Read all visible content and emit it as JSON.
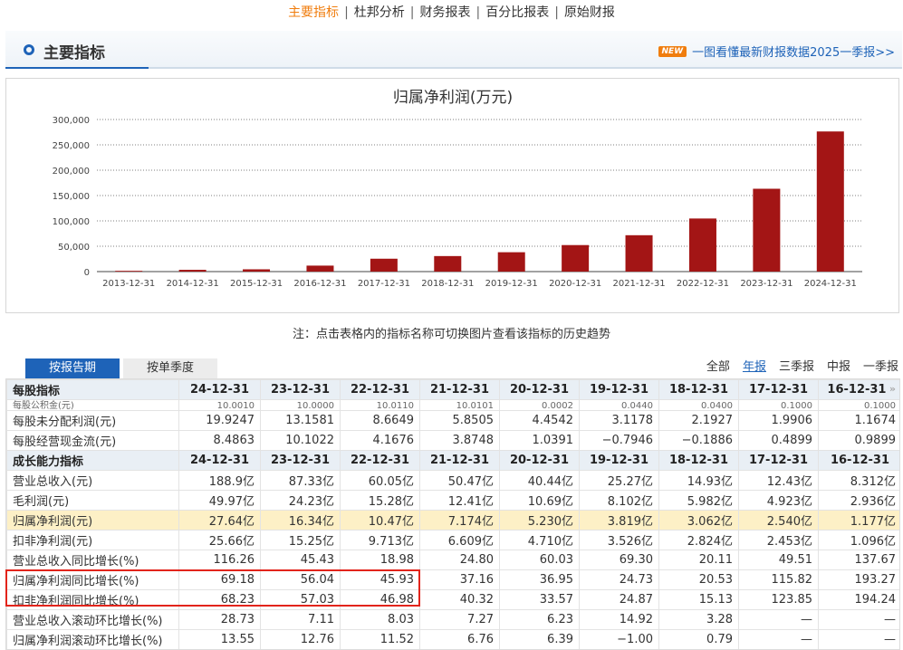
{
  "nav": {
    "items": [
      "主要指标",
      "杜邦分析",
      "财务报表",
      "百分比报表",
      "原始财报"
    ],
    "active": "主要指标"
  },
  "section": {
    "title": "主要指标",
    "news_badge": "NEW",
    "news_text": "一图看懂最新财报数据2025一季报>>"
  },
  "chart_data": {
    "type": "bar",
    "title": "归属净利润(万元)",
    "categories": [
      "2013-12-31",
      "2014-12-31",
      "2015-12-31",
      "2016-12-31",
      "2017-12-31",
      "2018-12-31",
      "2019-12-31",
      "2020-12-31",
      "2021-12-31",
      "2022-12-31",
      "2023-12-31",
      "2024-12-31"
    ],
    "values": [
      1500,
      3500,
      4500,
      11770,
      25400,
      30620,
      38190,
      52300,
      71740,
      104700,
      163400,
      276400
    ],
    "yticks": [
      "0",
      "50,000",
      "100,000",
      "150,000",
      "200,000",
      "250,000",
      "300,000"
    ],
    "ylim": [
      0,
      300000
    ],
    "bar_color": "#a31515",
    "grid": true
  },
  "note": "注：点击表格内的指标名称可切换图片查看该指标的历史趋势",
  "tabs": {
    "report": "按报告期",
    "quarter": "按单季度"
  },
  "period_filter": {
    "items": [
      "全部",
      "年报",
      "三季报",
      "中报",
      "一季报"
    ],
    "active": "年报"
  },
  "table": {
    "columns": [
      "24-12-31",
      "23-12-31",
      "22-12-31",
      "21-12-31",
      "20-12-31",
      "19-12-31",
      "18-12-31",
      "17-12-31",
      "16-12-31"
    ],
    "header1": "每股指标",
    "partial_row": {
      "name": "每股公积金(元)",
      "values": [
        "10.0010",
        "10.0000",
        "10.0110",
        "10.0101",
        "0.0002",
        "0.0440",
        "0.0400",
        "0.1000",
        "0.1000"
      ]
    },
    "group1": [
      {
        "name": "每股未分配利润(元)",
        "values": [
          "19.9247",
          "13.1581",
          "8.6649",
          "5.8505",
          "4.4542",
          "3.1178",
          "2.1927",
          "1.9906",
          "1.1674"
        ]
      },
      {
        "name": "每股经营现金流(元)",
        "values": [
          "8.4863",
          "10.1022",
          "4.1676",
          "3.8748",
          "1.0391",
          "−0.7946",
          "−0.1886",
          "0.4899",
          "0.9899"
        ]
      }
    ],
    "header2": "成长能力指标",
    "group2": [
      {
        "name": "营业总收入(元)",
        "values": [
          "188.9亿",
          "87.33亿",
          "60.05亿",
          "50.47亿",
          "40.44亿",
          "25.27亿",
          "14.93亿",
          "12.43亿",
          "8.312亿"
        ]
      },
      {
        "name": "毛利润(元)",
        "values": [
          "49.97亿",
          "24.23亿",
          "15.28亿",
          "12.41亿",
          "10.69亿",
          "8.102亿",
          "5.982亿",
          "4.923亿",
          "2.936亿"
        ]
      },
      {
        "name": "归属净利润(元)",
        "values": [
          "27.64亿",
          "16.34亿",
          "10.47亿",
          "7.174亿",
          "5.230亿",
          "3.819亿",
          "3.062亿",
          "2.540亿",
          "1.177亿"
        ],
        "highlight": true
      },
      {
        "name": "扣非净利润(元)",
        "values": [
          "25.66亿",
          "15.25亿",
          "9.713亿",
          "6.609亿",
          "4.710亿",
          "3.526亿",
          "2.824亿",
          "2.453亿",
          "1.096亿"
        ]
      },
      {
        "name": "营业总收入同比增长(%)",
        "values": [
          "116.26",
          "45.43",
          "18.98",
          "24.80",
          "60.03",
          "69.30",
          "20.11",
          "49.51",
          "137.67"
        ]
      },
      {
        "name": "归属净利润同比增长(%)",
        "values": [
          "69.18",
          "56.04",
          "45.93",
          "37.16",
          "36.95",
          "24.73",
          "20.53",
          "115.82",
          "193.27"
        ]
      },
      {
        "name": "扣非净利润同比增长(%)",
        "values": [
          "68.23",
          "57.03",
          "46.98",
          "40.32",
          "33.57",
          "24.87",
          "15.13",
          "123.85",
          "194.24"
        ]
      },
      {
        "name": "营业总收入滚动环比增长(%)",
        "values": [
          "28.73",
          "7.11",
          "8.03",
          "7.27",
          "6.23",
          "14.92",
          "3.28",
          "—",
          "—"
        ]
      },
      {
        "name": "归属净利润滚动环比增长(%)",
        "values": [
          "13.55",
          "12.76",
          "11.52",
          "6.76",
          "6.39",
          "−1.00",
          "0.79",
          "—",
          "—"
        ]
      }
    ]
  }
}
